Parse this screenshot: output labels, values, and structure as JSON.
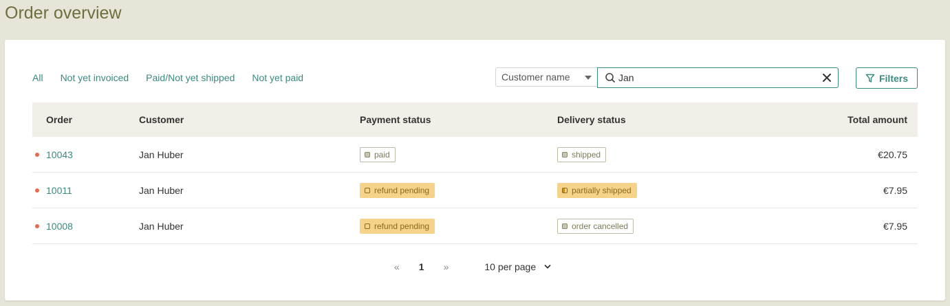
{
  "page": {
    "title": "Order overview"
  },
  "tabs": [
    {
      "label": "All"
    },
    {
      "label": "Not yet invoiced"
    },
    {
      "label": "Paid/Not yet shipped"
    },
    {
      "label": "Not yet paid"
    }
  ],
  "search": {
    "field_selected": "Customer name",
    "value": "Jan",
    "icon": "search-icon",
    "clear_icon": "close-icon"
  },
  "filters": {
    "label": "Filters",
    "icon": "funnel-icon"
  },
  "table": {
    "headers": {
      "order": "Order",
      "customer": "Customer",
      "payment": "Payment status",
      "delivery": "Delivery status",
      "total": "Total amount"
    },
    "rows": [
      {
        "order": "10043",
        "customer": "Jan Huber",
        "payment": "paid",
        "delivery": "shipped",
        "total": "€20.75"
      },
      {
        "order": "10011",
        "customer": "Jan Huber",
        "payment": "refund pending",
        "delivery": "partially shipped",
        "total": "€7.95"
      },
      {
        "order": "10008",
        "customer": "Jan Huber",
        "payment": "refund pending",
        "delivery": "order cancelled",
        "total": "€7.95"
      }
    ]
  },
  "pagination": {
    "prev": "«",
    "current": "1",
    "next": "»",
    "per_page": "10 per page"
  },
  "colors": {
    "accent": "#3a8a80",
    "title": "#6f6e3f",
    "background": "#e7e4d8",
    "warning_badge": "#f6d38a",
    "unread_dot": "#e8694c"
  }
}
